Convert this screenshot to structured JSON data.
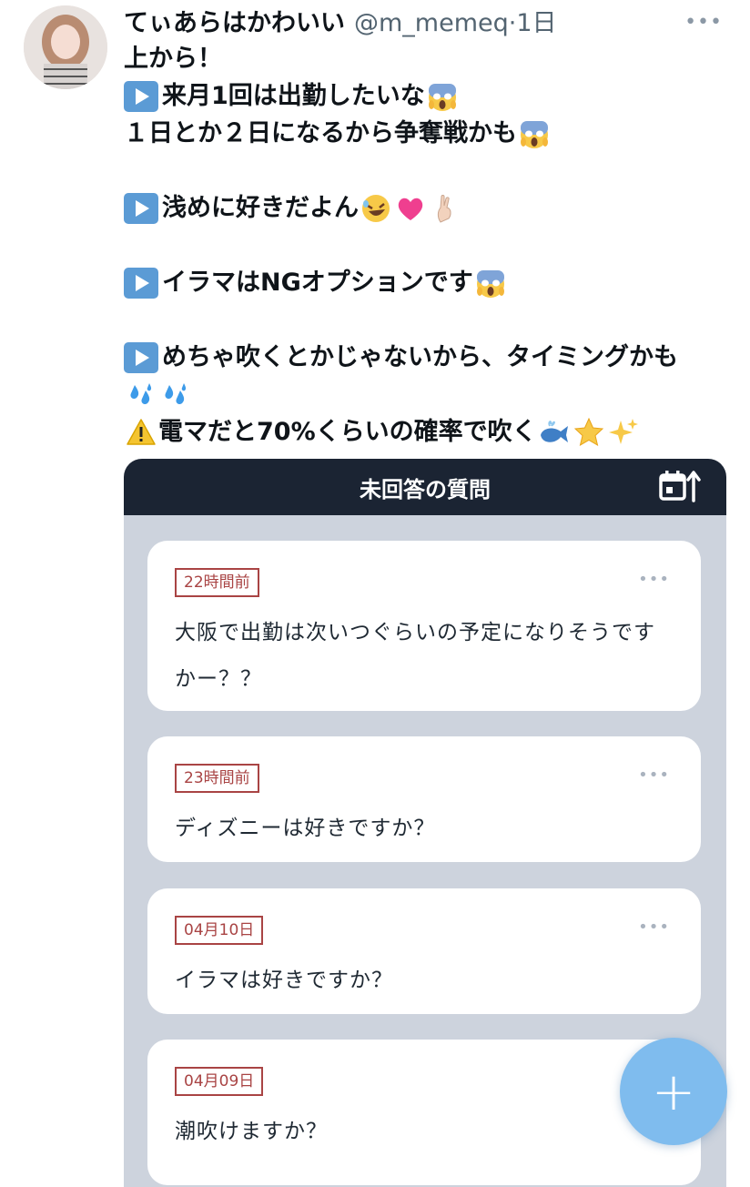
{
  "tweet": {
    "display_name": "てぃあらはかわいい",
    "handle": "@m_memeq",
    "time": "1日",
    "lines": [
      "上から！",
      "来月1回は出勤したいな",
      "１日とか２日になるから争奪戦かも",
      "",
      "浅めに好きだよん",
      "",
      "イラマはNGオプションです",
      "",
      "めちゃ吹くとかじゃないから、タイミングかも",
      "",
      "電マだと70%くらいの確率で吹く"
    ]
  },
  "qa_card": {
    "title": "未回答の質問",
    "questions": [
      {
        "time": "22時間前",
        "text": "大阪で出勤は次いつぐらいの予定になりそうですかー？？"
      },
      {
        "time": "23時間前",
        "text": "ディズニーは好きですか？"
      },
      {
        "time": "04月10日",
        "text": "イラマは好きですか？"
      },
      {
        "time": "04月09日",
        "text": "潮吹けますか？"
      }
    ]
  },
  "fab_label": "+",
  "colors": {
    "card_header": "#1b2433",
    "card_bg": "#cdd3dd",
    "badge": "#a94444",
    "fab": "#7fbcee"
  }
}
